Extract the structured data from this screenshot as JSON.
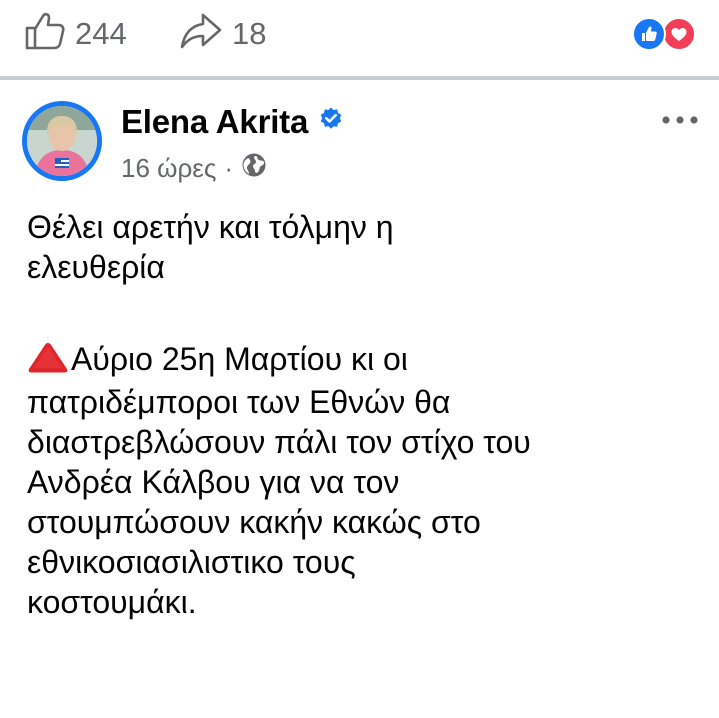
{
  "action_bar": {
    "like_count": "244",
    "share_count": "18",
    "reaction_icons": [
      "like-reaction-icon",
      "love-reaction-icon"
    ]
  },
  "post": {
    "author_name": "Elena Akrita",
    "verified": true,
    "timestamp": "16 ώρες",
    "separator": "·",
    "audience_icon": "globe-icon",
    "paragraphs": [
      "Θέλει αρετήν και τόλμην η\nελευθερία",
      "Αύριο 25η Μαρτίου κι οι\nπατριδέμποροι των Εθνών θα\nδιαστρεβλώσουν πάλι τον στίχο του\nΑνδρέα Κάλβου για να τον\nστουμπώσουν κακήν κακώς στο\nεθνικοσιασιλιστικο τους\nκοστουμάκι."
    ],
    "emoji": "red-triangle-pointed-up"
  },
  "colors": {
    "facebook_blue": "#1877f2",
    "love_red": "#f33e58",
    "secondary_text": "#65676b",
    "divider": "#c9ccd1",
    "triangle_red": "#e0262c"
  }
}
